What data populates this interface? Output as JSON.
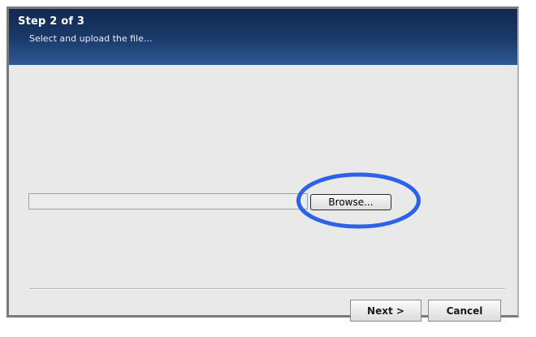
{
  "header": {
    "title": "Step 2 of 3",
    "subtitle": "Select and upload the file..."
  },
  "upload": {
    "file_path": "",
    "browse_label": "Browse..."
  },
  "footer": {
    "next_label": "Next >",
    "cancel_label": "Cancel"
  },
  "colors": {
    "header_dark": "#10294f",
    "header_light": "#2e5b96",
    "highlight_ring": "#2b62e8",
    "panel_bg": "#e9e9e9"
  }
}
